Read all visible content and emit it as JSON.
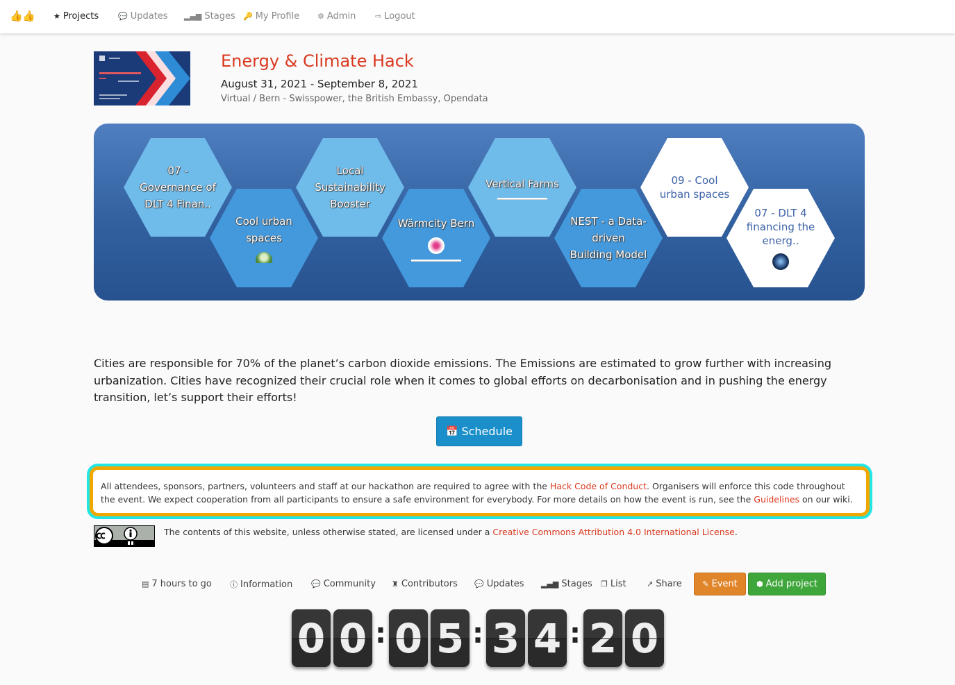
{
  "nav": {
    "brand_icon": "thumbs-up-icon",
    "items": [
      {
        "label": "Projects",
        "icon": "star-icon",
        "glyph": "★",
        "active": true
      },
      {
        "label": "Updates",
        "icon": "comment-icon",
        "glyph": "💬"
      },
      {
        "label": "Stages",
        "icon": "signal-icon",
        "glyph": "▂▄▆"
      },
      {
        "label": "My Profile",
        "icon": "key-icon",
        "glyph": "🔑"
      },
      {
        "label": "Admin",
        "icon": "gear-icon",
        "glyph": "⚙"
      },
      {
        "label": "Logout",
        "icon": "sign-out-icon",
        "glyph": "⇨"
      }
    ]
  },
  "event": {
    "title": "Energy & Climate Hack",
    "dates": "August 31, 2021 - September 8, 2021",
    "venue": "Virtual / Bern - Swisspower, the British Embassy, Opendata"
  },
  "projects": [
    {
      "label": "07 - Governance of DLT 4 Finan..",
      "style": "light"
    },
    {
      "label": "Cool urban spaces",
      "style": "mid",
      "logo": "green-seal"
    },
    {
      "label": "Local Sustainability Booster",
      "style": "light"
    },
    {
      "label": "Wärmcity Bern",
      "style": "mid",
      "logo": "pink-check",
      "bar": true
    },
    {
      "label": "Vertical Farms",
      "style": "light",
      "bar": true
    },
    {
      "label": "NEST - a Data-driven Building Model",
      "style": "mid"
    },
    {
      "label": "09 - Cool urban spaces",
      "style": "white"
    },
    {
      "label": "07 - DLT 4 financing the energ..",
      "style": "white",
      "logo": "dark-globe"
    }
  ],
  "description": "Cities are responsible for 70% of the planet’s carbon dioxide emissions. The Emissions are estimated to grow further with increasing urbanization. Cities have recognized their crucial role when it comes to global efforts on decarbonisation and in pushing the energy transition, let’s support their efforts!",
  "schedule_button": {
    "label": "Schedule",
    "icon": "calendar-icon"
  },
  "code_of_conduct": {
    "text_1": "All attendees, sponsors, partners, volunteers and staff at our hackathon are required to agree with the ",
    "link_1": "Hack Code of Conduct",
    "text_2": ". Organisers will enforce this code throughout the event. We expect cooperation from all participants to ensure a safe environment for everybody. For more details on how the event is run, see the ",
    "link_2": "Guidelines",
    "text_3": " on our wiki."
  },
  "license": {
    "text": "The contents of this website, unless otherwise stated, are licensed under a ",
    "link": "Creative Commons Attribution 4.0 International License",
    "end": ".",
    "badge": "cc-by-badge"
  },
  "footer": {
    "items": [
      {
        "label": "7 hours to go",
        "icon": "id-card-icon",
        "glyph": "▤"
      },
      {
        "label": "Information",
        "icon": "info-icon",
        "glyph": "ⓘ"
      },
      {
        "label": "Community",
        "icon": "comment-icon",
        "glyph": "💬"
      },
      {
        "label": "Contributors",
        "icon": "person-icon",
        "glyph": "♜"
      },
      {
        "label": "Updates",
        "icon": "comment-icon",
        "glyph": "💬"
      },
      {
        "label": "Stages",
        "icon": "signal-icon",
        "glyph": "▂▄▆"
      },
      {
        "label": "List",
        "icon": "files-icon",
        "glyph": "❐"
      },
      {
        "label": "Share",
        "icon": "external-link-icon",
        "glyph": "↗"
      }
    ],
    "event_button": "Event",
    "add_project_button": "Add project"
  },
  "countdown": [
    "0",
    "0",
    "0",
    "5",
    "3",
    "4",
    "2",
    "0"
  ],
  "colors": {
    "accent": "#d9381e",
    "schedule": "#1a8fc9",
    "event_btn": "#e0852a",
    "add_btn": "#3fa63c",
    "coc_border": "#f0a800",
    "coc_glow": "#22e5e5"
  }
}
